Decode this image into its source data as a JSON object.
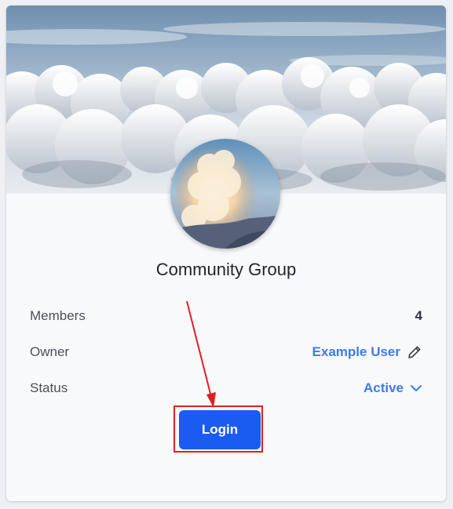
{
  "group": {
    "name": "Community Group"
  },
  "details": [
    {
      "label": "Members",
      "value": "4"
    },
    {
      "label": "Owner",
      "value": "Example User",
      "icon": "pencil-icon"
    },
    {
      "label": "Status",
      "value": "Active",
      "icon": "chevron-down-icon"
    }
  ],
  "actions": {
    "login_label": "Login"
  },
  "colors": {
    "accent": "#3f7be6",
    "button": "#1a5cf2",
    "highlight": "#e02020"
  }
}
